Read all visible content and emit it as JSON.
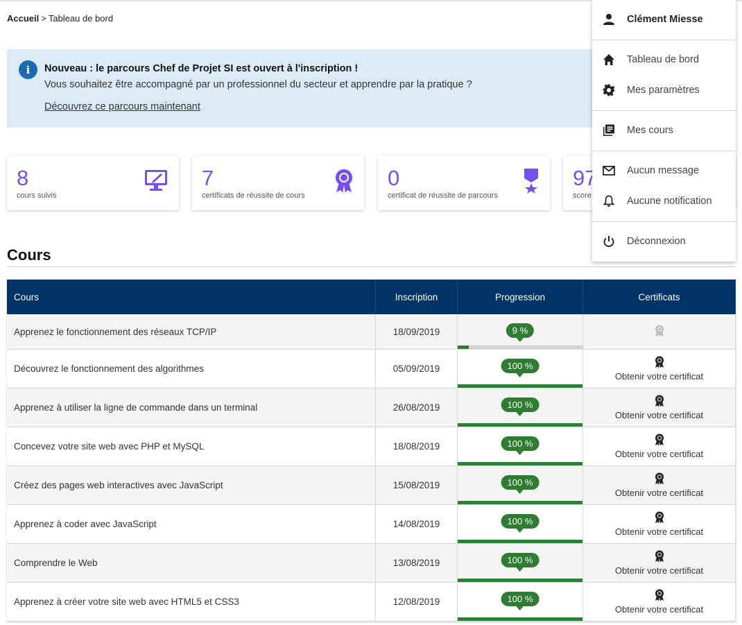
{
  "breadcrumb": {
    "home": "Accueil",
    "separator": ">",
    "current": "Tableau de bord"
  },
  "announcement": {
    "icon": "info-icon",
    "title": "Nouveau : le parcours Chef de Projet SI est ouvert à l'inscription !",
    "text": "Vous souhaitez être accompagné par un professionnel du secteur et apprendre par la pratique ?",
    "link": "Découvrez ce parcours maintenant"
  },
  "stats": [
    {
      "value": "8",
      "label": "cours suivis",
      "icon": "monitor-pencil-icon"
    },
    {
      "value": "7",
      "label": "certificats de réussite de cours",
      "icon": "rosette-icon"
    },
    {
      "value": "0",
      "label": "certificat de réussite de parcours",
      "icon": "banner-star-icon"
    },
    {
      "value": "97",
      "label": "score",
      "icon": "score-icon"
    }
  ],
  "courses_section": {
    "title": "Cours"
  },
  "table": {
    "headers": {
      "course": "Cours",
      "enrollment": "Inscription",
      "progress": "Progression",
      "certificates": "Certificats"
    },
    "rows": [
      {
        "name": "Apprenez le fonctionnement des réseaux TCP/IP",
        "date": "18/09/2019",
        "progress_label": "9 %",
        "progress": 9,
        "certificate": ""
      },
      {
        "name": "Découvrez le fonctionnement des algorithmes",
        "date": "05/09/2019",
        "progress_label": "100 %",
        "progress": 100,
        "certificate": "Obtenir votre certificat"
      },
      {
        "name": "Apprenez à utiliser la ligne de commande dans un terminal",
        "date": "26/08/2019",
        "progress_label": "100 %",
        "progress": 100,
        "certificate": "Obtenir votre certificat"
      },
      {
        "name": "Concevez votre site web avec PHP et MySQL",
        "date": "18/08/2019",
        "progress_label": "100 %",
        "progress": 100,
        "certificate": "Obtenir votre certificat"
      },
      {
        "name": "Créez des pages web interactives avec JavaScript",
        "date": "15/08/2019",
        "progress_label": "100 %",
        "progress": 100,
        "certificate": "Obtenir votre certificat"
      },
      {
        "name": "Apprenez à coder avec JavaScript",
        "date": "14/08/2019",
        "progress_label": "100 %",
        "progress": 100,
        "certificate": "Obtenir votre certificat"
      },
      {
        "name": "Comprendre le Web",
        "date": "13/08/2019",
        "progress_label": "100 %",
        "progress": 100,
        "certificate": "Obtenir votre certificat"
      },
      {
        "name": "Apprenez à créer votre site web avec HTML5 et CSS3",
        "date": "12/08/2019",
        "progress_label": "100 %",
        "progress": 100,
        "certificate": "Obtenir votre certificat"
      }
    ]
  },
  "user_menu": {
    "user": "Clément Miesse",
    "items": [
      {
        "label": "Tableau de bord",
        "icon": "home-icon"
      },
      {
        "label": "Mes paramètres",
        "icon": "gear-icon"
      },
      {
        "label": "Mes cours",
        "icon": "courses-icon"
      },
      {
        "label": "Aucun message",
        "icon": "mail-icon"
      },
      {
        "label": "Aucune notification",
        "icon": "bell-icon"
      },
      {
        "label": "Déconnexion",
        "icon": "power-icon"
      }
    ]
  },
  "colors": {
    "primary": "#7451eb",
    "table_header": "#003366",
    "progress": "#2e7d32",
    "info_bg": "#dcebf8"
  }
}
